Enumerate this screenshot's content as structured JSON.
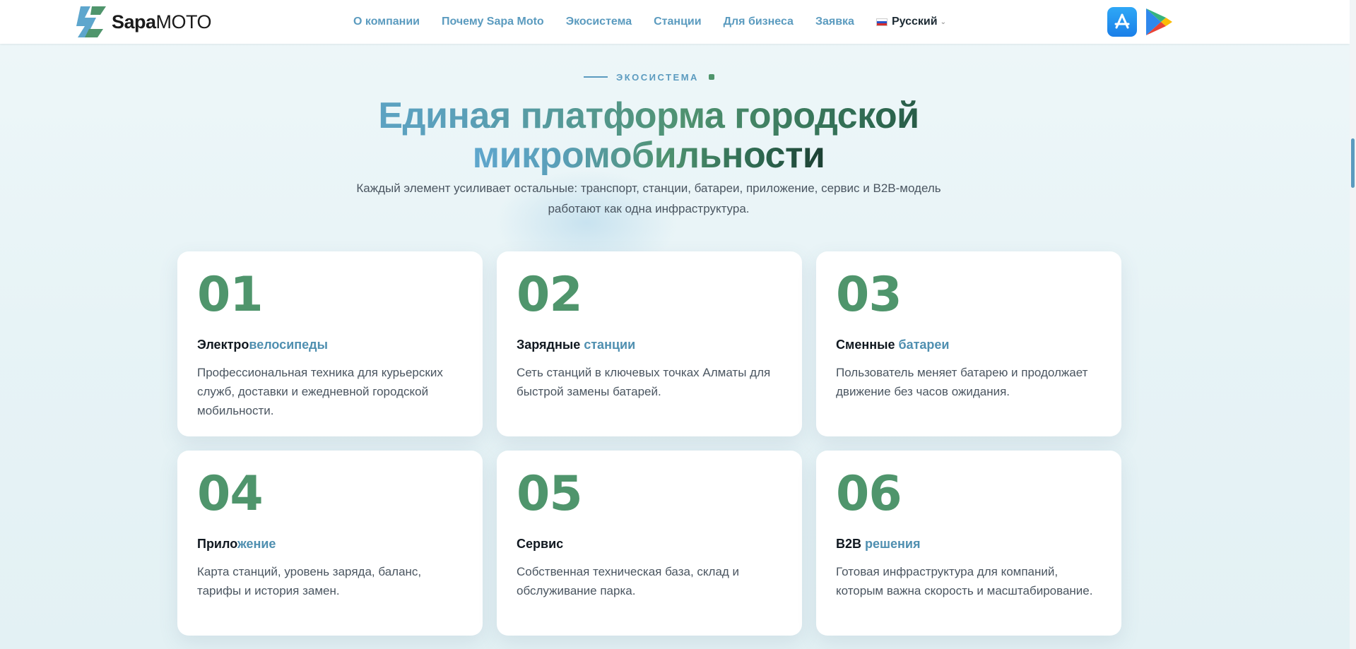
{
  "header": {
    "logo": {
      "brand_bold": "Sapa",
      "brand_light": "MOTO"
    },
    "nav": [
      "О компании",
      "Почему Sapa Moto",
      "Экосистема",
      "Станции",
      "Для бизнеса",
      "Заявка"
    ],
    "language": {
      "label": "Русский",
      "flag": "ru-flag-icon"
    },
    "stores": [
      {
        "name": "app-store-icon"
      },
      {
        "name": "google-play-icon"
      }
    ]
  },
  "section": {
    "eyebrow": "ЭКОСИСТЕМА",
    "title_line1": "Единая платформа городской",
    "title_line2": "микромобильности",
    "subtitle_line1": "Каждый элемент усиливает остальные: транспорт, станции, батареи, приложение, сервис и B2B-модель",
    "subtitle_line2": "работают как одна инфраструктура."
  },
  "cards": [
    {
      "num": "01",
      "title_a": "Электро",
      "title_b": "велосипеды",
      "desc": "Профессиональная техника для курьерских служб, доставки и ежедневной городской мобильности."
    },
    {
      "num": "02",
      "title_a": "Зарядные ",
      "title_b": "станции",
      "desc": "Сеть станций в ключевых точках Алматы для быстрой замены батарей."
    },
    {
      "num": "03",
      "title_a": "Сменные ",
      "title_b": "батареи",
      "desc": "Пользователь меняет батарею и продолжает движение без часов ожидания."
    },
    {
      "num": "04",
      "title_a": "Прило",
      "title_b": "жение",
      "desc": "Карта станций, уровень заряда, баланс, тарифы и история замен."
    },
    {
      "num": "05",
      "title_a": "Сервис",
      "title_b": "",
      "desc": "Собственная техническая база, склад и обслуживание парка."
    },
    {
      "num": "06",
      "title_a": "B2B ",
      "title_b": "решения",
      "desc": "Готовая инфраструктура для компаний, которым важна скорость и масштабирование."
    }
  ],
  "colors": {
    "accent_blue": "#5b9bbf",
    "accent_green": "#4f956c",
    "dark": "#101820"
  }
}
